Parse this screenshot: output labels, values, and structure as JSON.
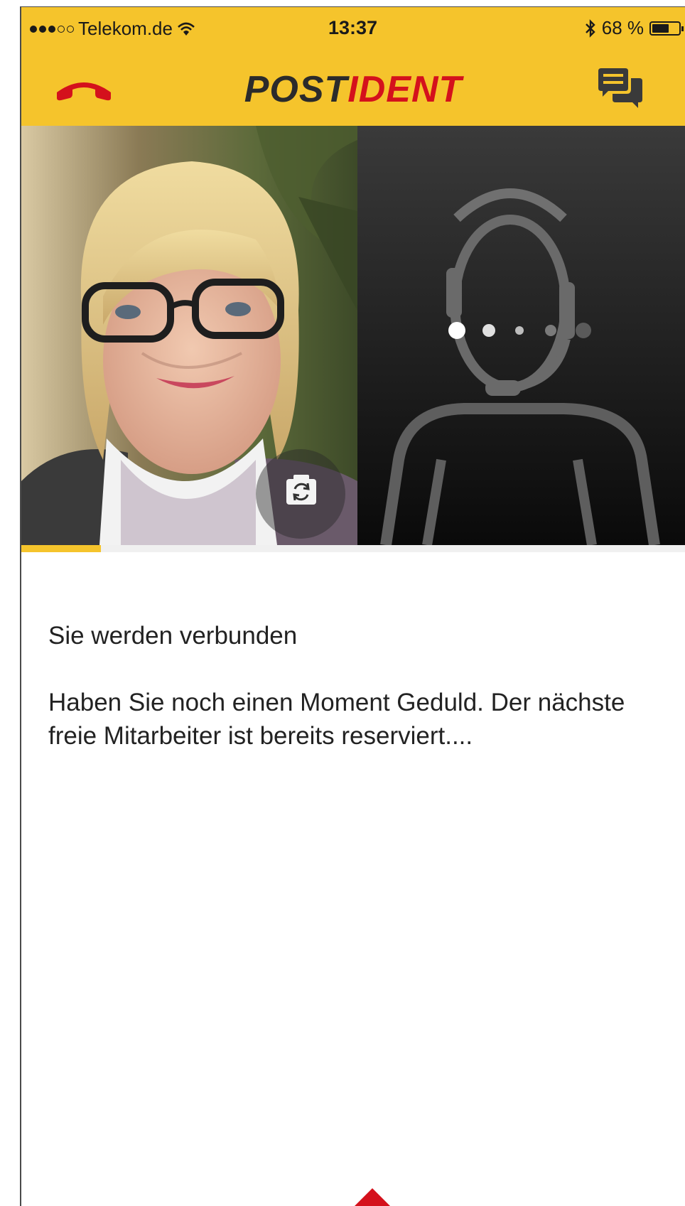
{
  "status_bar": {
    "carrier": "Telekom.de",
    "time": "13:37",
    "battery": "68 %",
    "battery_level": 0.68,
    "signal_bars_filled": 3,
    "signal_bars_total": 5,
    "icons": [
      "wifi-icon",
      "bluetooth-icon",
      "battery-icon"
    ]
  },
  "header": {
    "brand_part1": "POST",
    "brand_part2": "IDENT",
    "left_icon": "hangup-icon",
    "right_icon": "chat-icon",
    "brand_colors": {
      "yellow": "#f5c42c",
      "red": "#d4111c",
      "dark": "#2b2b2b"
    }
  },
  "video": {
    "switch_camera_icon": "camera-switch-icon",
    "agent_placeholder_icon": "agent-headset-icon",
    "connecting_dots": 5
  },
  "progress": {
    "value": 0.12,
    "color": "#f5c42c"
  },
  "message": {
    "title": "Sie werden verbunden",
    "body": "Haben Sie noch einen Moment Geduld. Der nächste freie Mitarbeiter ist bereits reserviert...."
  },
  "bottom_icon": "chevron-up-icon"
}
